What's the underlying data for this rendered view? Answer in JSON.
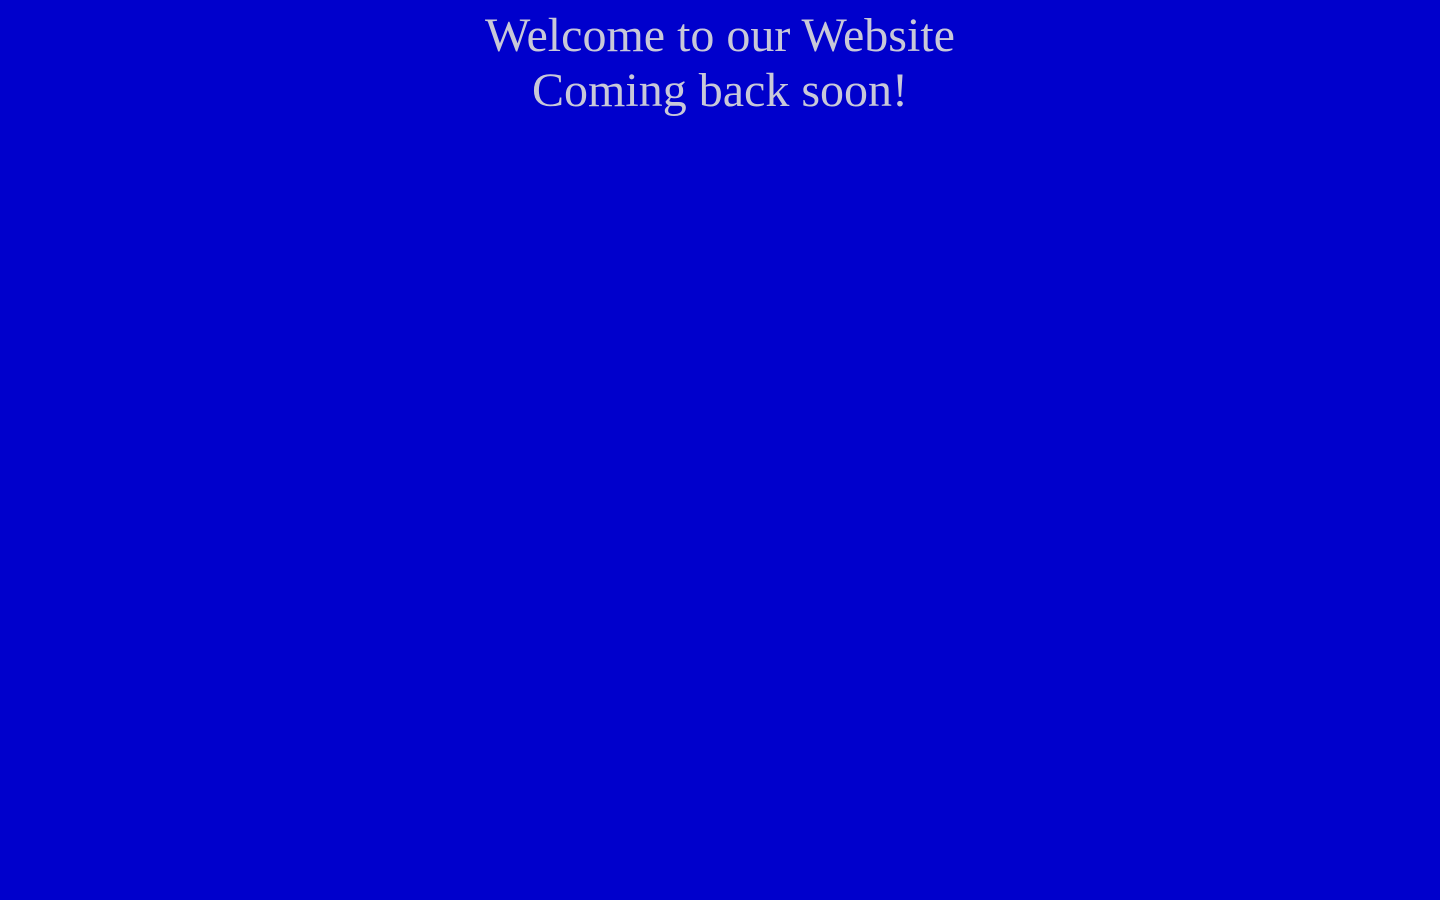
{
  "page": {
    "background_color": "#0000CC",
    "text_color": "#C8C8D8"
  },
  "message": {
    "line1": "Welcome to our Website",
    "line2": "Coming back soon!"
  }
}
